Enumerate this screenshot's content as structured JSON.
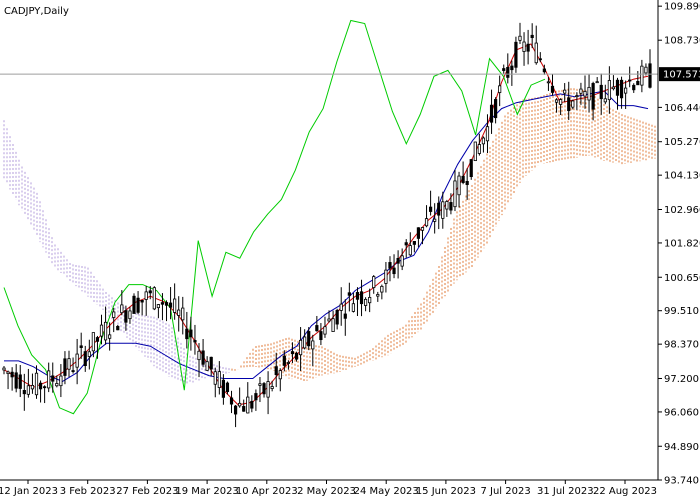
{
  "chart_data": {
    "type": "candlestick",
    "title": "CADJPY,Daily",
    "current_price": "107.573",
    "y_ticks": [
      "109.890",
      "108.730",
      "107.573",
      "106.440",
      "105.270",
      "104.130",
      "102.960",
      "101.820",
      "100.650",
      "99.510",
      "98.370",
      "97.200",
      "96.060",
      "94.890",
      "93.740"
    ],
    "x_ticks": [
      "12 Jan 2023",
      "3 Feb 2023",
      "27 Feb 2023",
      "19 Mar 2023",
      "10 Apr 2023",
      "2 May 2023",
      "24 May 2023",
      "15 Jun 2023",
      "7 Jul 2023",
      "31 Jul 2023",
      "22 Aug 2023"
    ],
    "ylim": [
      93.74,
      110.1
    ],
    "colors": {
      "candle": "#000000",
      "tenkan": "#cc0000",
      "kijun": "#0000aa",
      "chikou": "#00cc00",
      "cloud_bull": "#e07b39",
      "cloud_bear": "#b39ddb",
      "price_line": "#9e9e9e"
    },
    "tenkan": [
      97.5,
      97.2,
      96.9,
      97.1,
      97.4,
      97.8,
      98.3,
      98.9,
      99.4,
      99.8,
      100.0,
      99.8,
      99.3,
      98.5,
      97.6,
      96.8,
      96.3,
      96.4,
      96.9,
      97.5,
      98.0,
      98.6,
      99.0,
      99.6,
      100.0,
      100.2,
      100.6,
      101.3,
      102.0,
      102.6,
      103.0,
      103.7,
      104.7,
      105.8,
      107.3,
      108.4,
      108.6,
      107.7,
      106.6,
      106.7,
      106.8,
      107.0,
      107.2,
      107.4,
      107.5
    ],
    "kijun": [
      97.8,
      97.8,
      97.6,
      97.3,
      97.1,
      97.4,
      98.0,
      98.4,
      98.4,
      98.4,
      98.3,
      98.0,
      97.7,
      97.5,
      97.3,
      97.2,
      97.2,
      97.2,
      97.6,
      98.0,
      98.3,
      99.0,
      99.4,
      99.7,
      100.2,
      100.5,
      100.8,
      101.2,
      101.4,
      102.2,
      103.5,
      104.5,
      105.3,
      105.9,
      106.4,
      106.6,
      106.7,
      106.8,
      106.9,
      106.8,
      106.9,
      107.0,
      106.5,
      106.5,
      106.4
    ],
    "chikou": [
      100.3,
      99.0,
      98.0,
      97.5,
      96.2,
      96.0,
      96.7,
      98.5,
      99.8,
      100.4,
      100.4,
      100.2,
      99.6,
      96.8,
      101.9,
      100.0,
      101.5,
      101.3,
      102.2,
      102.8,
      103.3,
      104.3,
      105.6,
      106.4,
      108.0,
      109.4,
      109.3,
      107.8,
      106.3,
      105.2,
      106.2,
      107.5,
      107.7,
      107.0,
      105.5,
      108.1,
      107.5,
      106.2,
      107.2,
      107.4
    ],
    "cloud_top": [
      106.0,
      104.5,
      103.5,
      101.8,
      101.1,
      101.0,
      100.2,
      99.7,
      99.4,
      99.3,
      99.0,
      98.0,
      97.8,
      97.6,
      97.5,
      98.3,
      98.4,
      98.6,
      98.4,
      98.3,
      98.0,
      97.9,
      98.2,
      98.7,
      99.0,
      99.8,
      101.0,
      102.8,
      103.8,
      105.0,
      106.2,
      106.7,
      106.8,
      107.0,
      107.1,
      107.0,
      106.5,
      106.2,
      106.0,
      105.8
    ],
    "cloud_bottom": [
      104.0,
      103.0,
      102.0,
      101.0,
      100.5,
      100.0,
      99.5,
      98.8,
      98.2,
      97.6,
      97.2,
      97.0,
      97.2,
      97.3,
      97.5,
      97.6,
      97.5,
      97.2,
      97.1,
      97.3,
      97.4,
      97.6,
      97.8,
      98.0,
      98.4,
      98.9,
      99.7,
      100.5,
      101.0,
      101.9,
      103.0,
      104.0,
      104.5,
      104.6,
      104.7,
      104.8,
      104.6,
      104.5,
      104.6,
      104.7
    ]
  }
}
